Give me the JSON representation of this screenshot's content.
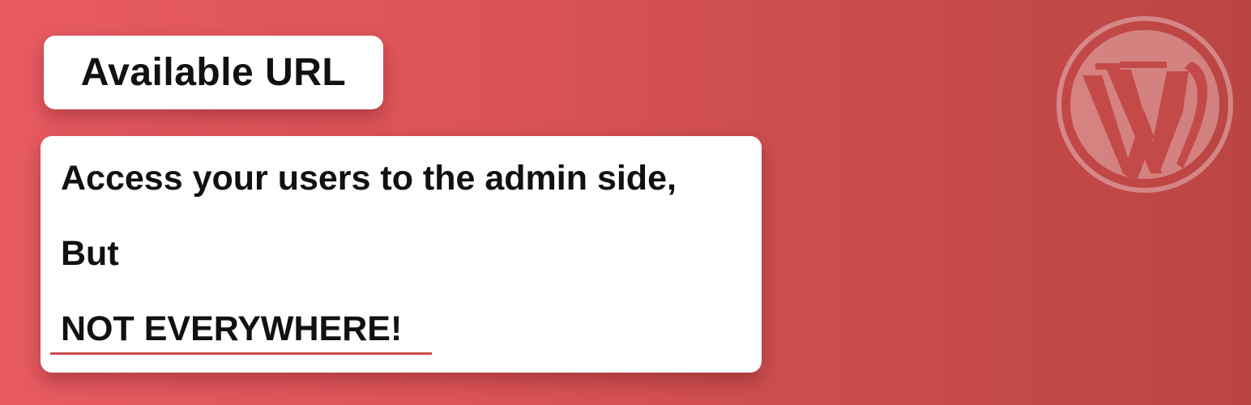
{
  "banner": {
    "background_colors": [
      "#e85a62",
      "#dd5459",
      "#c94c4b",
      "#bb4542"
    ],
    "accent_color": "#d0484c",
    "title_label": "Available URL",
    "message": {
      "line1": "Access your users to the admin side,",
      "line2": "But",
      "line3": "NOT EVERYWHERE!"
    },
    "logo_icon": "wordpress-icon"
  }
}
